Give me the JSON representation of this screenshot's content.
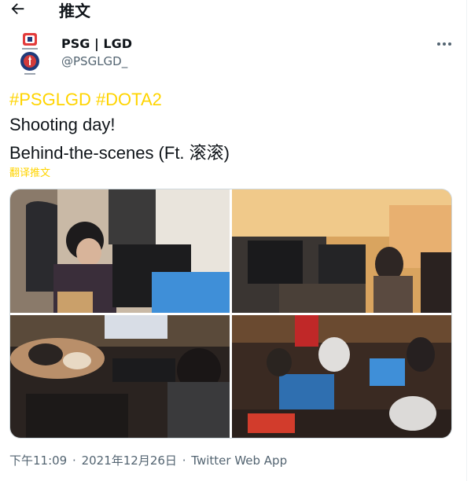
{
  "header": {
    "title": "推文",
    "back_icon": "arrow-left-icon"
  },
  "user": {
    "name": "PSG | LGD",
    "handle": "@PSGLGD_",
    "avatar_icon": "psg-lgd-logo-icon",
    "more_icon": "more-horizontal-icon"
  },
  "tweet": {
    "hashtags": [
      "#PSGLGD",
      "#DOTA2"
    ],
    "line1": "Shooting day!",
    "line2": "Behind-the-scenes (Ft. 滚滚)",
    "translate_label": "翻译推文"
  },
  "media": {
    "photos": [
      {
        "description_icon": "photo-player-at-monitor"
      },
      {
        "description_icon": "photo-gaming-room"
      },
      {
        "description_icon": "photo-cat-on-desk"
      },
      {
        "description_icon": "photo-team-playing"
      }
    ]
  },
  "meta": {
    "time": "下午11:09",
    "date": "2021年12月26日",
    "separator": "·",
    "source": "Twitter Web App"
  },
  "colors": {
    "accent": "#ffd400",
    "text": "#0f1419",
    "secondary": "#536471"
  }
}
